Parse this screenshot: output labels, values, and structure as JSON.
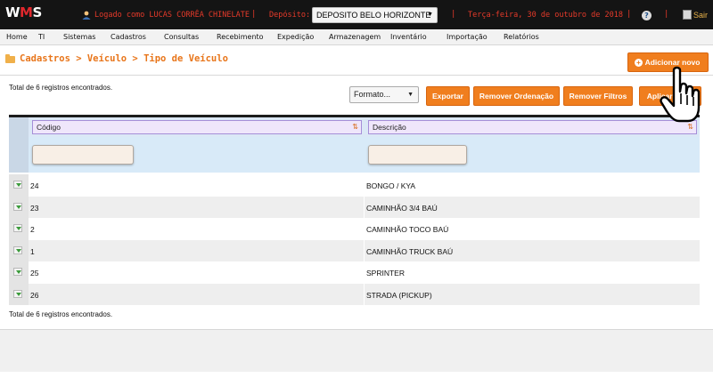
{
  "app": {
    "logo_prefix": "W",
    "logo_accent": "M",
    "logo_suffix": "S"
  },
  "topbar": {
    "logged_as": "Logado como LUCAS CORRÊA CHINELATE",
    "separator": "|",
    "deposit_label": "Depósito:",
    "deposit_value": "DEPOSITO BELO HORIZONTE",
    "date": "Terça-feira, 30 de outubro de 2018",
    "help": "?",
    "exit_label": "Sair"
  },
  "menu": {
    "items": [
      "Home",
      "TI",
      "Sistemas",
      "Cadastros",
      "Consultas",
      "Recebimento",
      "Expedição",
      "Armazenagem",
      "Inventário",
      "Importação",
      "Relatórios"
    ]
  },
  "page": {
    "breadcrumb": "Cadastros > Veículo > Tipo de Veículo",
    "add_button": "Adicionar novo",
    "add_icon": "+",
    "count_top": "Total de 6 registros encontrados.",
    "count_bottom": "Total de 6 registros encontrados."
  },
  "toolbar": {
    "format_select": "Formato...",
    "export": "Exportar",
    "remove_sort": "Remover Ordenação",
    "remove_filters": "Remover Filtros",
    "apply_filter": "Aplicar Filtro"
  },
  "table": {
    "columns": [
      "Código",
      "Descrição"
    ],
    "sort_icon": "⇅",
    "rows": [
      {
        "code": "24",
        "description": "BONGO / KYA"
      },
      {
        "code": "23",
        "description": "CAMINHÃO 3/4 BAÚ"
      },
      {
        "code": "2",
        "description": "CAMINHÃO TOCO BAÚ"
      },
      {
        "code": "1",
        "description": "CAMINHÃO TRUCK BAÚ"
      },
      {
        "code": "25",
        "description": "SPRINTER"
      },
      {
        "code": "26",
        "description": "STRADA (PICKUP)"
      }
    ]
  },
  "colors": {
    "accent": "#f07e1e",
    "topbar": "#141414",
    "topbar_text": "#e63a2a",
    "breadcrumb": "#e8751a"
  },
  "icons": {
    "user": "user-icon",
    "help": "help-icon",
    "exit": "exit-icon",
    "folder": "folder-icon",
    "plus": "plus-circle-icon",
    "sort": "sort-icon",
    "expand": "expand-row-icon",
    "cursor": "hand-pointer-icon"
  }
}
